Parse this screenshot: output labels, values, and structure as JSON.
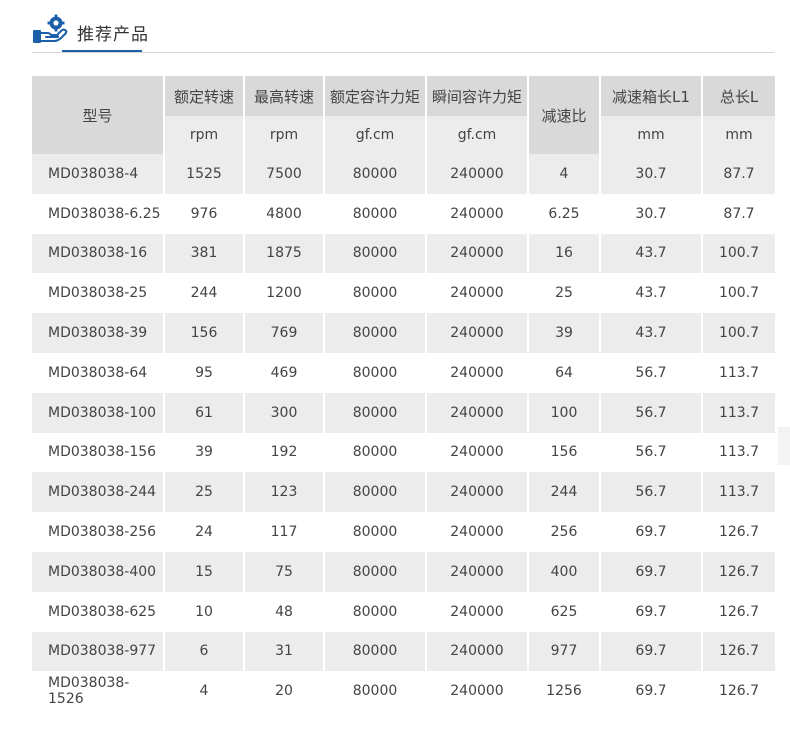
{
  "header": {
    "title": "推荐产品",
    "icon": "hand-gear-icon",
    "accent_color": "#1a5fa8"
  },
  "table": {
    "columns": [
      {
        "label": "型号",
        "unit": ""
      },
      {
        "label": "额定转速",
        "unit": "rpm"
      },
      {
        "label": "最高转速",
        "unit": "rpm"
      },
      {
        "label": "额定容许力矩",
        "unit": "gf.cm"
      },
      {
        "label": "瞬间容许力矩",
        "unit": "gf.cm"
      },
      {
        "label": "减速比",
        "unit": ""
      },
      {
        "label": "减速箱长L1",
        "unit": "mm"
      },
      {
        "label": "总长L",
        "unit": "mm"
      }
    ],
    "rows": [
      [
        "MD038038-4",
        "1525",
        "7500",
        "80000",
        "240000",
        "4",
        "30.7",
        "87.7"
      ],
      [
        "MD038038-6.25",
        "976",
        "4800",
        "80000",
        "240000",
        "6.25",
        "30.7",
        "87.7"
      ],
      [
        "MD038038-16",
        "381",
        "1875",
        "80000",
        "240000",
        "16",
        "43.7",
        "100.7"
      ],
      [
        "MD038038-25",
        "244",
        "1200",
        "80000",
        "240000",
        "25",
        "43.7",
        "100.7"
      ],
      [
        "MD038038-39",
        "156",
        "769",
        "80000",
        "240000",
        "39",
        "43.7",
        "100.7"
      ],
      [
        "MD038038-64",
        "95",
        "469",
        "80000",
        "240000",
        "64",
        "56.7",
        "113.7"
      ],
      [
        "MD038038-100",
        "61",
        "300",
        "80000",
        "240000",
        "100",
        "56.7",
        "113.7"
      ],
      [
        "MD038038-156",
        "39",
        "192",
        "80000",
        "240000",
        "156",
        "56.7",
        "113.7"
      ],
      [
        "MD038038-244",
        "25",
        "123",
        "80000",
        "240000",
        "244",
        "56.7",
        "113.7"
      ],
      [
        "MD038038-256",
        "24",
        "117",
        "80000",
        "240000",
        "256",
        "69.7",
        "126.7"
      ],
      [
        "MD038038-400",
        "15",
        "75",
        "80000",
        "240000",
        "400",
        "69.7",
        "126.7"
      ],
      [
        "MD038038-625",
        "10",
        "48",
        "80000",
        "240000",
        "625",
        "69.7",
        "126.7"
      ],
      [
        "MD038038-977",
        "6",
        "31",
        "80000",
        "240000",
        "977",
        "69.7",
        "126.7"
      ],
      [
        "MD038038-1526",
        "4",
        "20",
        "80000",
        "240000",
        "1256",
        "69.7",
        "126.7"
      ]
    ]
  }
}
